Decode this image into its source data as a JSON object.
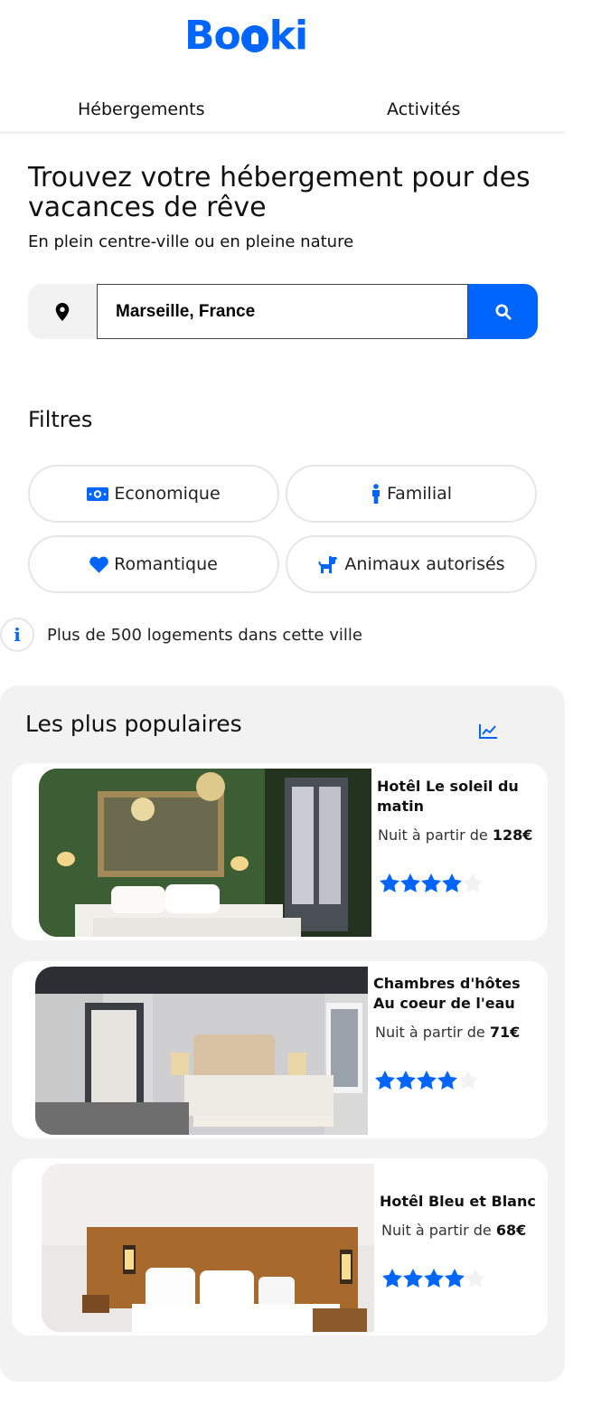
{
  "logo": {
    "left": "Bo",
    "right": "ki"
  },
  "nav": {
    "items": [
      "Hébergements",
      "Activités"
    ]
  },
  "hero": {
    "title": "Trouvez votre hébergement pour des vacances de rêve",
    "subtitle": "En plein centre-ville ou en pleine nature"
  },
  "search": {
    "value": "Marseille, France",
    "icon": "location-pin-icon",
    "button_icon": "search-icon"
  },
  "filters": {
    "title": "Filtres",
    "items": [
      {
        "label": "Economique",
        "icon": "money-icon"
      },
      {
        "label": "Familial",
        "icon": "person-icon"
      },
      {
        "label": "Romantique",
        "icon": "heart-icon"
      },
      {
        "label": "Animaux autorisés",
        "icon": "dog-icon"
      }
    ]
  },
  "info": {
    "text": "Plus de 500 logements dans cette ville",
    "icon": "info-icon"
  },
  "popular": {
    "title": "Les plus populaires",
    "icon": "trend-chart-icon",
    "hotels": [
      {
        "name": "Hotêl Le soleil du matin",
        "price_prefix": "Nuit à partir de",
        "price": "128€",
        "rating": 4,
        "max_rating": 5
      },
      {
        "name": "Chambres d'hôtes Au coeur de l'eau",
        "price_prefix": "Nuit à partir de",
        "price": "71€",
        "rating": 4,
        "max_rating": 5
      },
      {
        "name": "Hotêl Bleu et Blanc",
        "price_prefix": "Nuit à partir de",
        "price": "68€",
        "rating": 4,
        "max_rating": 5
      }
    ]
  },
  "colors": {
    "accent": "#0065FC",
    "panel": "#F2F2F2",
    "border": "#E6E6E6"
  }
}
